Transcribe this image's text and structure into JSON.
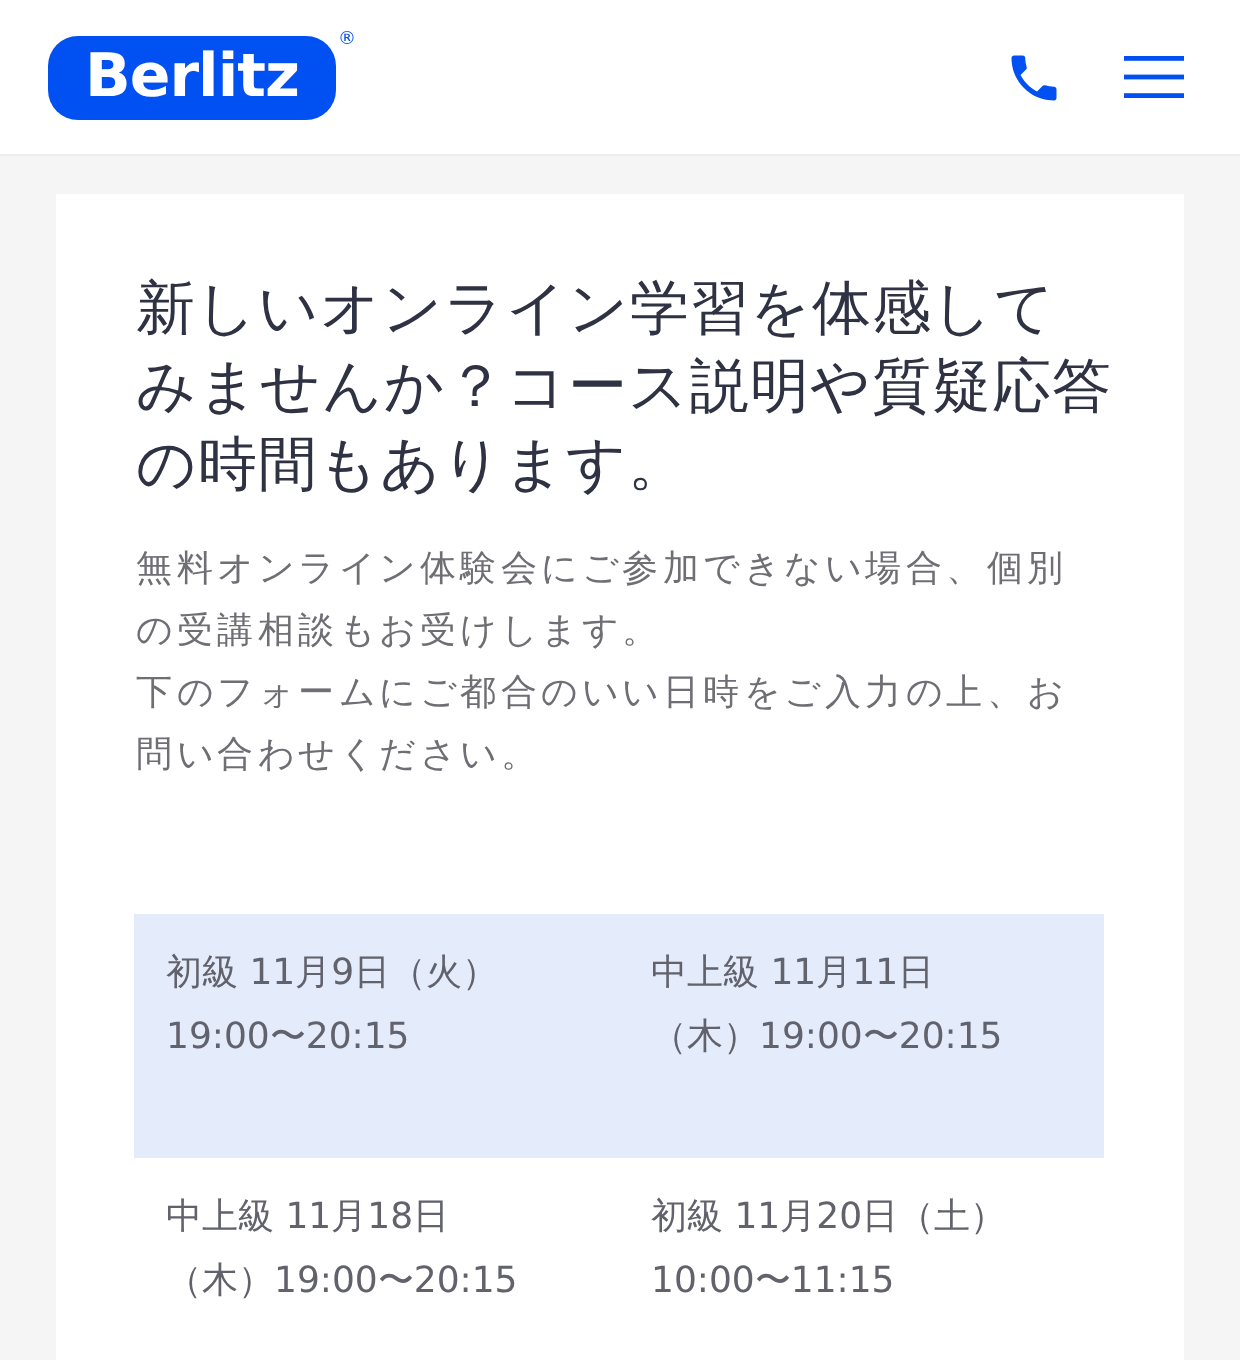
{
  "header": {
    "logo": {
      "text": "Berlitz",
      "registered_mark": "®"
    }
  },
  "intro": {
    "title": "新しいオンライン学習を体感してみませんか？コース説明や質疑応答の時間もあります。",
    "description": [
      "無料オンライン体験会にご参加できない場合、個別の受講相談もお受けします。",
      "下のフォームにご都合のいい日時をご入力の上、お問い合わせください。"
    ]
  },
  "schedule": {
    "rows": [
      {
        "cells": [
          "初級 11月9日（火）19:00〜20:15",
          "中上級 11月11日（木）19:00〜20:15"
        ]
      },
      {
        "cells": [
          "中上級 11月18日（木）19:00〜20:15",
          "初級 11月20日（土）10:00〜11:15"
        ]
      }
    ]
  }
}
